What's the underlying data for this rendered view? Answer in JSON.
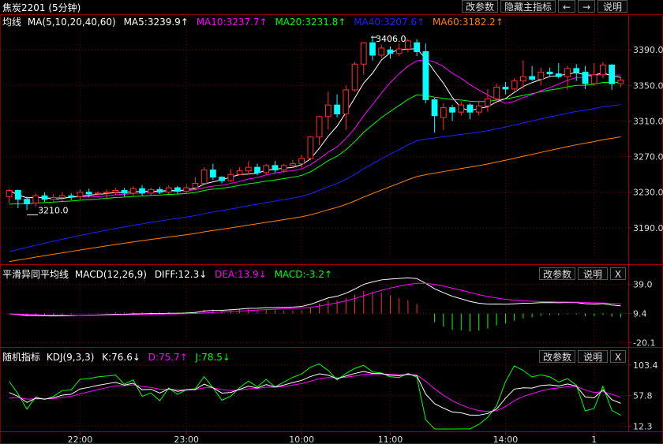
{
  "header": {
    "title": "焦炭2201 (5分钟)",
    "buttons": [
      "改参数",
      "隐藏主指标",
      "←",
      "→",
      "说明"
    ]
  },
  "colors": {
    "up": "#ff3030",
    "down": "#00ffff",
    "ma5": "#ffffff",
    "ma10": "#ff00ff",
    "ma20": "#00ff00",
    "ma40": "#2020ff",
    "ma60": "#ff8000",
    "grid": "#7a0000",
    "dea": "#ff00ff",
    "macd_green": "#00ff00"
  },
  "main_panel": {
    "legend": {
      "name": "均线",
      "params": "MA(5,10,20,40,60)",
      "ma5": "MA5:3239.9↑",
      "ma10": "MA10:3237.7↑",
      "ma20": "MA20:3231.8↑",
      "ma40": "MA40:3207.6↑",
      "ma60": "MA60:3182.2↑"
    },
    "annotations": {
      "high": "3406.0",
      "low": "3210.0"
    }
  },
  "macd_panel": {
    "legend": {
      "name": "平滑异同平均线",
      "params": "MACD(12,26,9)",
      "diff": "DIFF:12.3↓",
      "dea": "DEA:13.9↓",
      "macd": "MACD:-3.2↑"
    },
    "buttons": [
      "改参数",
      "说明",
      "X"
    ]
  },
  "kdj_panel": {
    "legend": {
      "name": "随机指标",
      "params": "KDJ(9,3,3)",
      "k": "K:76.6↓",
      "d": "D:75.7↑",
      "j": "J:78.5↓"
    },
    "buttons": [
      "改参数",
      "说明",
      "X"
    ]
  },
  "chart_data": [
    {
      "type": "candlestick",
      "title": "焦炭2201 (5分钟)",
      "ylim": [
        3150,
        3415
      ],
      "yticks": [
        "3390.0",
        "3350.0",
        "3310.0",
        "3270.0",
        "3230.0",
        "3190.0"
      ],
      "ytick_values": [
        3390,
        3350,
        3310,
        3270,
        3230,
        3190
      ],
      "xticks": [
        "22:00",
        "23:00",
        "10:00",
        "11:00",
        "14:00",
        "1"
      ],
      "xtick_index": [
        8,
        20,
        33,
        43,
        56,
        66
      ],
      "high_point": {
        "index": 41,
        "value": 3406.0
      },
      "low_point": {
        "index": 2,
        "value": 3210.0
      },
      "candles": [
        [
          3225,
          3232,
          3234,
          3218
        ],
        [
          3232,
          3222,
          3233,
          3212
        ],
        [
          3222,
          3217,
          3225,
          3210
        ],
        [
          3218,
          3226,
          3229,
          3214
        ],
        [
          3226,
          3222,
          3230,
          3219
        ],
        [
          3222,
          3224,
          3228,
          3218
        ],
        [
          3224,
          3226,
          3230,
          3220
        ],
        [
          3226,
          3225,
          3229,
          3221
        ],
        [
          3225,
          3230,
          3233,
          3222
        ],
        [
          3230,
          3228,
          3234,
          3224
        ],
        [
          3228,
          3229,
          3231,
          3226
        ],
        [
          3229,
          3230,
          3233,
          3222
        ],
        [
          3230,
          3232,
          3235,
          3227
        ],
        [
          3232,
          3229,
          3235,
          3225
        ],
        [
          3229,
          3234,
          3237,
          3225
        ],
        [
          3234,
          3229,
          3238,
          3226
        ],
        [
          3229,
          3233,
          3235,
          3227
        ],
        [
          3233,
          3230,
          3236,
          3228
        ],
        [
          3230,
          3235,
          3238,
          3228
        ],
        [
          3235,
          3231,
          3237,
          3228
        ],
        [
          3231,
          3235,
          3239,
          3229
        ],
        [
          3235,
          3240,
          3247,
          3233
        ],
        [
          3240,
          3255,
          3258,
          3238
        ],
        [
          3255,
          3247,
          3262,
          3244
        ],
        [
          3247,
          3243,
          3248,
          3240
        ],
        [
          3243,
          3250,
          3256,
          3241
        ],
        [
          3250,
          3254,
          3258,
          3249
        ],
        [
          3254,
          3258,
          3265,
          3250
        ],
        [
          3258,
          3252,
          3262,
          3249
        ],
        [
          3252,
          3260,
          3262,
          3250
        ],
        [
          3260,
          3255,
          3265,
          3252
        ],
        [
          3255,
          3260,
          3262,
          3252
        ],
        [
          3260,
          3262,
          3266,
          3257
        ],
        [
          3262,
          3268,
          3272,
          3258
        ],
        [
          3268,
          3292,
          3293,
          3266
        ],
        [
          3292,
          3315,
          3316,
          3283
        ],
        [
          3315,
          3328,
          3343,
          3300
        ],
        [
          3328,
          3318,
          3340,
          3314
        ],
        [
          3318,
          3345,
          3350,
          3300
        ],
        [
          3345,
          3374,
          3376,
          3343
        ],
        [
          3374,
          3398,
          3398,
          3362
        ],
        [
          3398,
          3384,
          3406,
          3378
        ],
        [
          3384,
          3392,
          3396,
          3381
        ],
        [
          3390,
          3386,
          3394,
          3380
        ],
        [
          3386,
          3391,
          3397,
          3383
        ],
        [
          3391,
          3400,
          3402,
          3387
        ],
        [
          3398,
          3388,
          3402,
          3383
        ],
        [
          3388,
          3334,
          3397,
          3330
        ],
        [
          3334,
          3316,
          3336,
          3297
        ],
        [
          3314,
          3325,
          3330,
          3300
        ],
        [
          3325,
          3320,
          3328,
          3310
        ],
        [
          3320,
          3328,
          3332,
          3316
        ],
        [
          3328,
          3320,
          3330,
          3312
        ],
        [
          3320,
          3327,
          3333,
          3316
        ],
        [
          3327,
          3335,
          3346,
          3320
        ],
        [
          3335,
          3348,
          3352,
          3330
        ],
        [
          3348,
          3346,
          3354,
          3340
        ],
        [
          3346,
          3355,
          3358,
          3344
        ],
        [
          3355,
          3360,
          3378,
          3346
        ],
        [
          3360,
          3357,
          3372,
          3355
        ],
        [
          3357,
          3365,
          3370,
          3350
        ],
        [
          3365,
          3363,
          3370,
          3360
        ],
        [
          3363,
          3360,
          3375,
          3358
        ],
        [
          3360,
          3369,
          3372,
          3345
        ],
        [
          3369,
          3365,
          3374,
          3355
        ],
        [
          3365,
          3352,
          3372,
          3346
        ],
        [
          3352,
          3362,
          3375,
          3350
        ],
        [
          3362,
          3373,
          3376,
          3358
        ],
        [
          3373,
          3352,
          3374,
          3345
        ],
        [
          3352,
          3356,
          3360,
          3348
        ]
      ]
    },
    {
      "type": "line",
      "title": "MACD(12,26,9)",
      "ylim": [
        -22,
        44
      ],
      "yticks": [
        "39.0",
        "9.4",
        "-20.1"
      ],
      "ytick_values": [
        39.0,
        9.4,
        -20.1
      ],
      "series_names": [
        "DIFF",
        "DEA",
        "MACD"
      ]
    },
    {
      "type": "line",
      "title": "KDJ(9,3,3)",
      "ylim": [
        8,
        108
      ],
      "yticks": [
        "103.4",
        "57.8",
        "12.3"
      ],
      "ytick_values": [
        103.4,
        57.8,
        12.3
      ],
      "series_names": [
        "K",
        "D",
        "J"
      ]
    }
  ]
}
